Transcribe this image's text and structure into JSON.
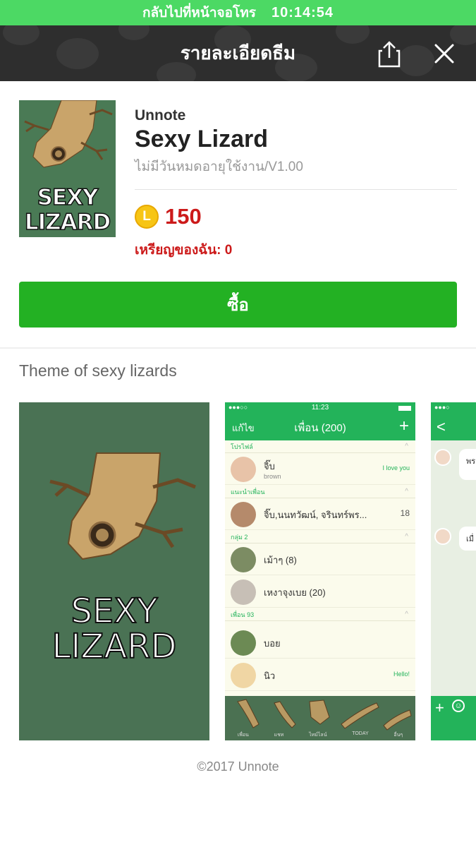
{
  "status_bar": {
    "return_text": "กลับไปที่หน้าจอโทร",
    "time": "10:14:54",
    "color": "#4cd964"
  },
  "header": {
    "title": "รายละเอียดธีม",
    "share_icon": "share-icon",
    "close_icon": "close-icon"
  },
  "product": {
    "author": "Unnote",
    "name": "Sexy Lizard",
    "validity": "ไม่มีวันหมดอายุใช้งาน/V1.00",
    "coin_symbol": "L",
    "price": "150",
    "my_coins": "เหรียญของฉัน: 0",
    "cover_text": [
      "SEXY",
      "LIZARD"
    ]
  },
  "buy_button": {
    "label": "ซื้อ",
    "color": "#23b123"
  },
  "description": "Theme of sexy lizards",
  "preview": {
    "cover_text": [
      "SEXY",
      "LIZARD"
    ],
    "friends": {
      "time": "11:23",
      "edit": "แก้ไข",
      "title": "เพื่อน (200)",
      "sections": {
        "profile": "โปรไฟล์",
        "suggested": "แนะนำเพื่อน",
        "group": "กลุ่ม 2",
        "friends": "เพื่อน 93"
      },
      "rows": [
        {
          "name": "จิ๊บ",
          "sub": "brown",
          "status": "I love you"
        },
        {
          "name": "จิ๊บ,นนทวัฒน์, จรินทร์พร...",
          "count": "18"
        },
        {
          "name": "เม้าๆ (8)"
        },
        {
          "name": "เหงาจุงเบย (20)"
        },
        {
          "name": "บอย"
        },
        {
          "name": "นิว",
          "status": "Hello!"
        }
      ],
      "tabs": [
        "เพื่อน",
        "แชท",
        "ไทม์ไลน์",
        "TODAY",
        "อื่นๆ"
      ]
    },
    "chat": {
      "bubbles": [
        "พร ไป",
        "เมื่"
      ]
    }
  },
  "footer": "©2017 Unnote"
}
